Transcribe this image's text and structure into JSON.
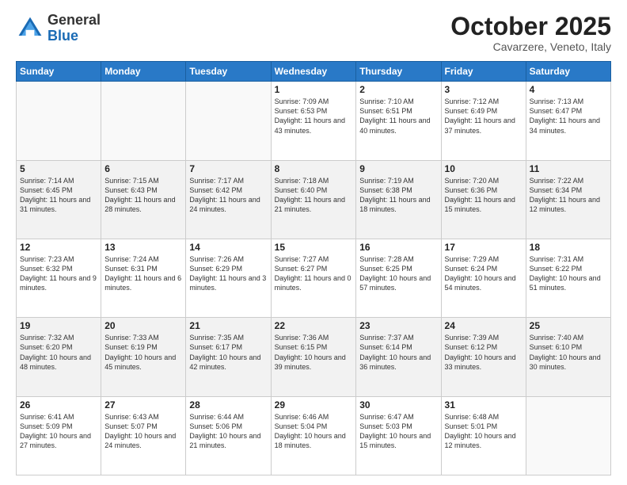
{
  "logo": {
    "general": "General",
    "blue": "Blue"
  },
  "title": "October 2025",
  "location": "Cavarzere, Veneto, Italy",
  "days_of_week": [
    "Sunday",
    "Monday",
    "Tuesday",
    "Wednesday",
    "Thursday",
    "Friday",
    "Saturday"
  ],
  "weeks": [
    [
      {
        "day": "",
        "sunrise": "",
        "sunset": "",
        "daylight": ""
      },
      {
        "day": "",
        "sunrise": "",
        "sunset": "",
        "daylight": ""
      },
      {
        "day": "",
        "sunrise": "",
        "sunset": "",
        "daylight": ""
      },
      {
        "day": "1",
        "sunrise": "Sunrise: 7:09 AM",
        "sunset": "Sunset: 6:53 PM",
        "daylight": "Daylight: 11 hours and 43 minutes."
      },
      {
        "day": "2",
        "sunrise": "Sunrise: 7:10 AM",
        "sunset": "Sunset: 6:51 PM",
        "daylight": "Daylight: 11 hours and 40 minutes."
      },
      {
        "day": "3",
        "sunrise": "Sunrise: 7:12 AM",
        "sunset": "Sunset: 6:49 PM",
        "daylight": "Daylight: 11 hours and 37 minutes."
      },
      {
        "day": "4",
        "sunrise": "Sunrise: 7:13 AM",
        "sunset": "Sunset: 6:47 PM",
        "daylight": "Daylight: 11 hours and 34 minutes."
      }
    ],
    [
      {
        "day": "5",
        "sunrise": "Sunrise: 7:14 AM",
        "sunset": "Sunset: 6:45 PM",
        "daylight": "Daylight: 11 hours and 31 minutes."
      },
      {
        "day": "6",
        "sunrise": "Sunrise: 7:15 AM",
        "sunset": "Sunset: 6:43 PM",
        "daylight": "Daylight: 11 hours and 28 minutes."
      },
      {
        "day": "7",
        "sunrise": "Sunrise: 7:17 AM",
        "sunset": "Sunset: 6:42 PM",
        "daylight": "Daylight: 11 hours and 24 minutes."
      },
      {
        "day": "8",
        "sunrise": "Sunrise: 7:18 AM",
        "sunset": "Sunset: 6:40 PM",
        "daylight": "Daylight: 11 hours and 21 minutes."
      },
      {
        "day": "9",
        "sunrise": "Sunrise: 7:19 AM",
        "sunset": "Sunset: 6:38 PM",
        "daylight": "Daylight: 11 hours and 18 minutes."
      },
      {
        "day": "10",
        "sunrise": "Sunrise: 7:20 AM",
        "sunset": "Sunset: 6:36 PM",
        "daylight": "Daylight: 11 hours and 15 minutes."
      },
      {
        "day": "11",
        "sunrise": "Sunrise: 7:22 AM",
        "sunset": "Sunset: 6:34 PM",
        "daylight": "Daylight: 11 hours and 12 minutes."
      }
    ],
    [
      {
        "day": "12",
        "sunrise": "Sunrise: 7:23 AM",
        "sunset": "Sunset: 6:32 PM",
        "daylight": "Daylight: 11 hours and 9 minutes."
      },
      {
        "day": "13",
        "sunrise": "Sunrise: 7:24 AM",
        "sunset": "Sunset: 6:31 PM",
        "daylight": "Daylight: 11 hours and 6 minutes."
      },
      {
        "day": "14",
        "sunrise": "Sunrise: 7:26 AM",
        "sunset": "Sunset: 6:29 PM",
        "daylight": "Daylight: 11 hours and 3 minutes."
      },
      {
        "day": "15",
        "sunrise": "Sunrise: 7:27 AM",
        "sunset": "Sunset: 6:27 PM",
        "daylight": "Daylight: 11 hours and 0 minutes."
      },
      {
        "day": "16",
        "sunrise": "Sunrise: 7:28 AM",
        "sunset": "Sunset: 6:25 PM",
        "daylight": "Daylight: 10 hours and 57 minutes."
      },
      {
        "day": "17",
        "sunrise": "Sunrise: 7:29 AM",
        "sunset": "Sunset: 6:24 PM",
        "daylight": "Daylight: 10 hours and 54 minutes."
      },
      {
        "day": "18",
        "sunrise": "Sunrise: 7:31 AM",
        "sunset": "Sunset: 6:22 PM",
        "daylight": "Daylight: 10 hours and 51 minutes."
      }
    ],
    [
      {
        "day": "19",
        "sunrise": "Sunrise: 7:32 AM",
        "sunset": "Sunset: 6:20 PM",
        "daylight": "Daylight: 10 hours and 48 minutes."
      },
      {
        "day": "20",
        "sunrise": "Sunrise: 7:33 AM",
        "sunset": "Sunset: 6:19 PM",
        "daylight": "Daylight: 10 hours and 45 minutes."
      },
      {
        "day": "21",
        "sunrise": "Sunrise: 7:35 AM",
        "sunset": "Sunset: 6:17 PM",
        "daylight": "Daylight: 10 hours and 42 minutes."
      },
      {
        "day": "22",
        "sunrise": "Sunrise: 7:36 AM",
        "sunset": "Sunset: 6:15 PM",
        "daylight": "Daylight: 10 hours and 39 minutes."
      },
      {
        "day": "23",
        "sunrise": "Sunrise: 7:37 AM",
        "sunset": "Sunset: 6:14 PM",
        "daylight": "Daylight: 10 hours and 36 minutes."
      },
      {
        "day": "24",
        "sunrise": "Sunrise: 7:39 AM",
        "sunset": "Sunset: 6:12 PM",
        "daylight": "Daylight: 10 hours and 33 minutes."
      },
      {
        "day": "25",
        "sunrise": "Sunrise: 7:40 AM",
        "sunset": "Sunset: 6:10 PM",
        "daylight": "Daylight: 10 hours and 30 minutes."
      }
    ],
    [
      {
        "day": "26",
        "sunrise": "Sunrise: 6:41 AM",
        "sunset": "Sunset: 5:09 PM",
        "daylight": "Daylight: 10 hours and 27 minutes."
      },
      {
        "day": "27",
        "sunrise": "Sunrise: 6:43 AM",
        "sunset": "Sunset: 5:07 PM",
        "daylight": "Daylight: 10 hours and 24 minutes."
      },
      {
        "day": "28",
        "sunrise": "Sunrise: 6:44 AM",
        "sunset": "Sunset: 5:06 PM",
        "daylight": "Daylight: 10 hours and 21 minutes."
      },
      {
        "day": "29",
        "sunrise": "Sunrise: 6:46 AM",
        "sunset": "Sunset: 5:04 PM",
        "daylight": "Daylight: 10 hours and 18 minutes."
      },
      {
        "day": "30",
        "sunrise": "Sunrise: 6:47 AM",
        "sunset": "Sunset: 5:03 PM",
        "daylight": "Daylight: 10 hours and 15 minutes."
      },
      {
        "day": "31",
        "sunrise": "Sunrise: 6:48 AM",
        "sunset": "Sunset: 5:01 PM",
        "daylight": "Daylight: 10 hours and 12 minutes."
      },
      {
        "day": "",
        "sunrise": "",
        "sunset": "",
        "daylight": ""
      }
    ]
  ]
}
